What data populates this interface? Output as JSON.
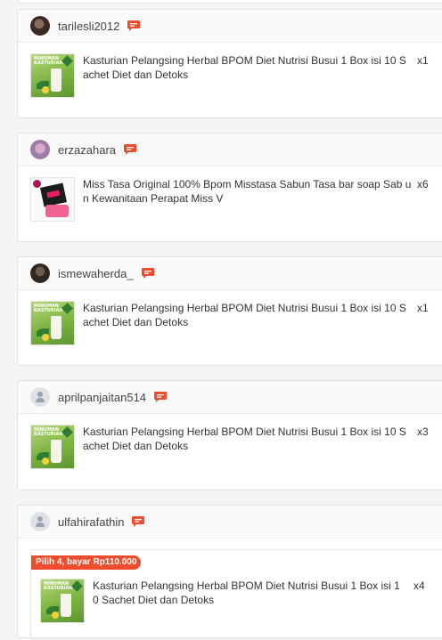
{
  "orders": [
    {
      "username": "tarilesli2012",
      "avatar": "user-photo",
      "product": "Kasturian Pelangsing Herbal BPOM Diet Nutrisi Busui 1 Box isi 10 Sachet Diet dan Detoks",
      "quantity": "x1",
      "thumbnail": "kasturian-product-icon"
    },
    {
      "username": "erzazahara",
      "avatar": "user-photo",
      "product": "Miss Tasa Original 100% Bpom Misstasa Sabun Tasa bar soap Sab un Kewanitaan Perapat Miss V",
      "quantity": "x6",
      "thumbnail": "misstasa-product-icon"
    },
    {
      "username": "ismewaherda_",
      "avatar": "user-photo",
      "product": "Kasturian Pelangsing Herbal BPOM Diet Nutrisi Busui 1 Box isi 10 Sachet Diet dan Detoks",
      "quantity": "x1",
      "thumbnail": "kasturian-product-icon"
    },
    {
      "username": "aprilpanjaitan514",
      "avatar": "default-avatar-icon",
      "product": "Kasturian Pelangsing Herbal BPOM Diet Nutrisi Busui 1 Box isi 10 Sachet Diet dan Detoks",
      "quantity": "x3",
      "thumbnail": "kasturian-product-icon"
    },
    {
      "username": "ulfahirafathin",
      "avatar": "default-avatar-icon",
      "bundle_label": "Pilih 4, bayar Rp110.000",
      "product": "Kasturian Pelangsing Herbal BPOM Diet Nutrisi Busui 1 Box isi 1 0 Sachet Diet dan Detoks",
      "quantity": "x4",
      "thumbnail": "kasturian-product-icon"
    }
  ],
  "colors": {
    "accent": "#ee4d2d",
    "chat_icon": "#ee4d2d",
    "card_bg": "#ffffff",
    "page_bg": "#f5f5f5"
  },
  "icons": {
    "chat": "chat-icon"
  },
  "thumbnail_text": "MINUMAN KASTURIAN"
}
